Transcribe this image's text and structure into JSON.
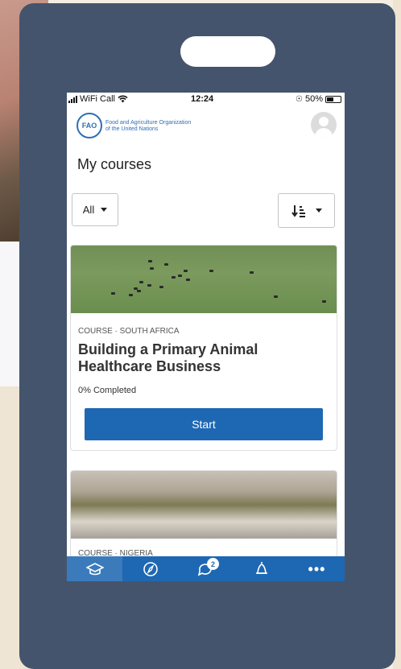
{
  "status_bar": {
    "carrier": "WiFi Call",
    "time": "12:24",
    "battery": "50%"
  },
  "header": {
    "org_line1": "Food and Agriculture Organization",
    "org_line2": "of the United Nations",
    "logo_text": "FAO"
  },
  "page": {
    "title": "My courses"
  },
  "filters": {
    "status_selected": "All"
  },
  "courses": [
    {
      "meta": "COURSE · SOUTH AFRICA",
      "title": "Building a Primary Animal Healthcare Business",
      "progress": "0% Completed",
      "action": "Start"
    },
    {
      "meta": "COURSE · NIGERIA"
    }
  ],
  "bottom_nav": {
    "items": [
      "courses-icon",
      "explore-icon",
      "discussions-icon",
      "notifications-icon",
      "more-icon"
    ],
    "discussions_badge": "2",
    "colors": {
      "nav": "#1e68b3",
      "active": "#3b7bbb"
    }
  },
  "colors": {
    "frame": "#45546d",
    "primary": "#1e68b3"
  }
}
